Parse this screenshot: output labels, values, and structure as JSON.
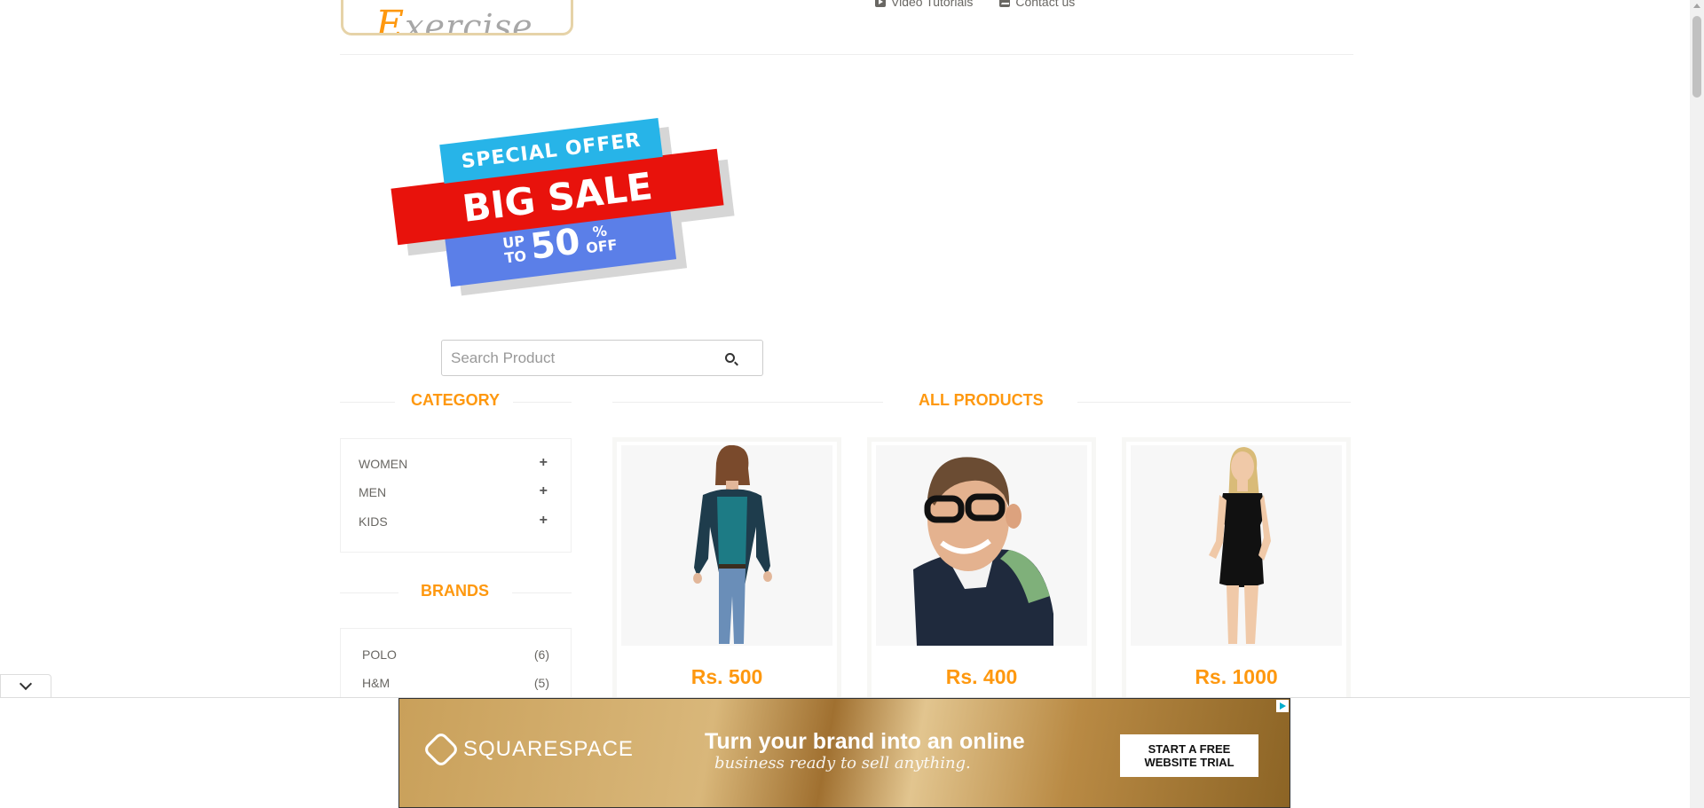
{
  "header": {
    "logo_cap": "E",
    "logo_rest": "xercise",
    "nav": [
      {
        "label": "Video Tutorials",
        "icon": "youtube-play-icon"
      },
      {
        "label": "Contact us",
        "icon": "envelope-icon"
      }
    ]
  },
  "banner": {
    "special": "SPECIAL OFFER",
    "big": "BIG SALE",
    "up": "UP",
    "to": "TO",
    "pct": "50",
    "pct_sign": "%",
    "off": "OFF"
  },
  "search": {
    "placeholder": "Search Product",
    "button_icon": "search-icon"
  },
  "sidebar": {
    "category_title": "CATEGORY",
    "categories": [
      {
        "label": "WOMEN",
        "toggle": "+"
      },
      {
        "label": "MEN",
        "toggle": "+"
      },
      {
        "label": "KIDS",
        "toggle": "+"
      }
    ],
    "brands_title": "BRANDS",
    "brands": [
      {
        "label": "POLO",
        "count": "(6)"
      },
      {
        "label": "H&M",
        "count": "(5)"
      }
    ]
  },
  "products": {
    "title": "ALL PRODUCTS",
    "items": [
      {
        "price": "Rs. 500",
        "image": "woman-teal-top-jeans"
      },
      {
        "price": "Rs. 400",
        "image": "man-glasses-polo"
      },
      {
        "price": "Rs. 1000",
        "image": "woman-black-dress"
      }
    ]
  },
  "ad": {
    "brand": "SQUARESPACE",
    "headline": "Turn your brand into an online",
    "sub": "business ready to sell anything.",
    "cta_line1": "START A FREE",
    "cta_line2": "WEBSITE TRIAL"
  },
  "colors": {
    "accent": "#fe980f",
    "text": "#696763",
    "special_offer": "#27b4e8",
    "big_sale": "#e8120c",
    "discount": "#5b7fe8"
  }
}
